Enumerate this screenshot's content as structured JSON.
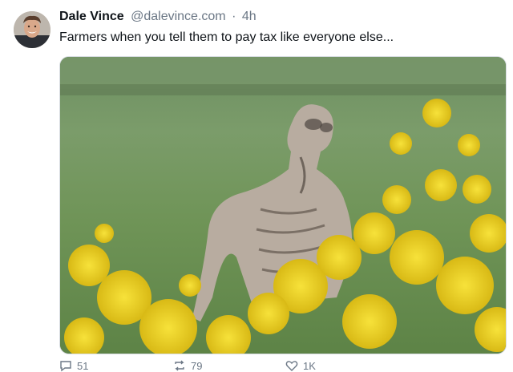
{
  "post": {
    "author": "Dale Vince",
    "handle": "@dalevince.com",
    "separator": "·",
    "time": "4h",
    "text": "Farmers when you tell them to pay tax like everyone else...",
    "media_icon": "image"
  },
  "actions": {
    "reply_count": "51",
    "repost_count": "79",
    "like_count": "1K",
    "reply_icon": "comment-icon",
    "repost_icon": "repost-icon",
    "like_icon": "heart-icon"
  },
  "colors": {
    "text": "#0f1419",
    "muted": "#6b7785",
    "flowers": "#f2d21b"
  }
}
